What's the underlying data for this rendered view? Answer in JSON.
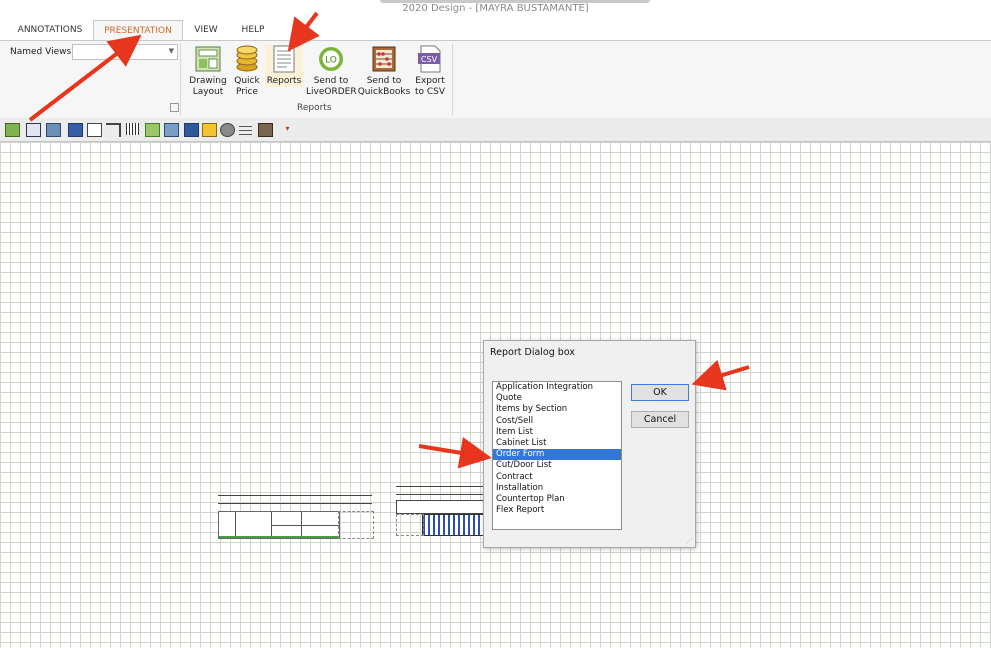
{
  "window": {
    "title": "2020 Design - [MAYRA BUSTAMANTE]"
  },
  "tabs": [
    {
      "label": "ANNOTATIONS",
      "active": false
    },
    {
      "label": "PRESENTATION",
      "active": true
    },
    {
      "label": "VIEW",
      "active": false
    },
    {
      "label": "HELP",
      "active": false
    }
  ],
  "ribbon": {
    "named_views_label": "Named Views",
    "named_views_value": "",
    "buttons": [
      {
        "label": "Drawing Layout",
        "icon": "drawing-layout-icon"
      },
      {
        "label": "Quick Price",
        "icon": "coins-icon"
      },
      {
        "label": "Reports",
        "icon": "report-document-icon"
      },
      {
        "label": "Send to LiveORDER",
        "icon": "liveorder-icon",
        "icon_text": "LO"
      },
      {
        "label": "Send to QuickBooks",
        "icon": "abacus-icon"
      },
      {
        "label": "Export to CSV",
        "icon": "csv-file-icon",
        "icon_text": "CSV"
      }
    ],
    "group_label": "Reports"
  },
  "dialog": {
    "title": "Report Dialog box",
    "items": [
      "Application Integration",
      "Quote",
      "Items by Section",
      "Cost/Sell",
      "Item List",
      "Cabinet List",
      "Order Form",
      "Cut/Door List",
      "Contract",
      "Installation",
      "Countertop Plan",
      "Flex Report"
    ],
    "selected": "Order Form",
    "ok_label": "OK",
    "cancel_label": "Cancel"
  },
  "colors": {
    "accent_tab": "#d06a1e",
    "selection": "#3478d6",
    "annotation_arrow": "#e8361e"
  }
}
